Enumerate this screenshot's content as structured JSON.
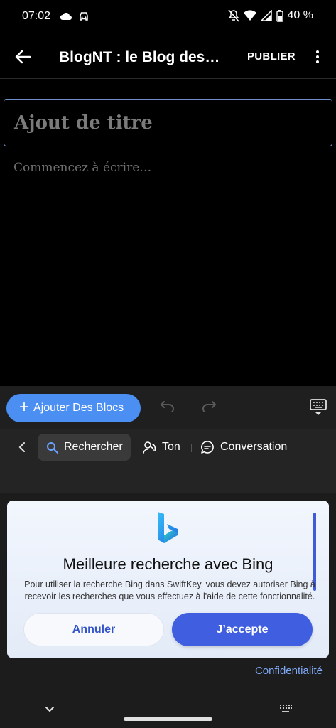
{
  "status_bar": {
    "time": "07:02",
    "battery": "40 %",
    "icons": [
      "cloud-icon",
      "car-icon",
      "notifications-off-icon",
      "wifi-icon",
      "signal-icon",
      "battery-icon"
    ]
  },
  "app_bar": {
    "title": "BlogNT : le Blog des…",
    "publish_label": "PUBLIER"
  },
  "editor": {
    "title_placeholder": "Ajout de titre",
    "body_placeholder": "Commencez à écrire…"
  },
  "editor_toolbar": {
    "add_blocks_label": "Ajouter Des Blocs"
  },
  "keyboard_suggestions": {
    "search_label": "Rechercher",
    "tone_label": "Ton",
    "conversation_label": "Conversation"
  },
  "bing_card": {
    "title": "Meilleure recherche avec Bing",
    "text": "Pour utiliser la recherche Bing dans SwiftKey, vous devez autoriser Bing à recevoir les recherches que vous effectuez à l'aide de cette fonctionnalité.",
    "cancel_label": "Annuler",
    "accept_label": "J’accepte"
  },
  "privacy_label": "Confidentialité",
  "colors": {
    "accent_blue": "#4b8ff2",
    "bing_button": "#3f5fe0",
    "link": "#7fa8f5",
    "title_field_border": "#6f8ec9"
  }
}
